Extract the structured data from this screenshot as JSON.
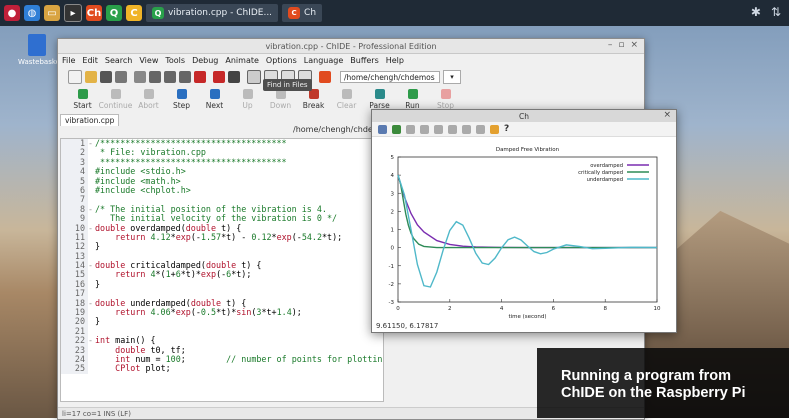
{
  "taskbar": {
    "tasks": [
      "vibration.cpp - ChIDE...",
      "Ch"
    ],
    "tray": [
      "bluetooth",
      "network"
    ]
  },
  "desktop": {
    "trash_label": "Wastebasket"
  },
  "window": {
    "title": "vibration.cpp - ChIDE - Professional Edition",
    "controls": [
      "–",
      "▫",
      "×"
    ],
    "menu": [
      "File",
      "Edit",
      "Search",
      "View",
      "Tools",
      "Debug",
      "Animate",
      "Options",
      "Language",
      "Buffers",
      "Help"
    ],
    "path_value": "/home/chengh/chdemos",
    "tooltip": "Find in Files",
    "debug_buttons": [
      {
        "label": "Start",
        "enabled": true
      },
      {
        "label": "Continue",
        "enabled": false
      },
      {
        "label": "Abort",
        "enabled": false
      },
      {
        "label": "Step",
        "enabled": true
      },
      {
        "label": "Next",
        "enabled": true
      },
      {
        "label": "Up",
        "enabled": false
      },
      {
        "label": "Down",
        "enabled": false
      },
      {
        "label": "Break",
        "enabled": true
      },
      {
        "label": "Clear",
        "enabled": false
      },
      {
        "label": "Parse",
        "enabled": true
      },
      {
        "label": "Run",
        "enabled": true
      },
      {
        "label": "Stop",
        "enabled": false
      }
    ],
    "tab": "vibration.cpp",
    "file_path": "/home/chengh/chdemos/vi",
    "status": "li=17 co=1 INS (LF)"
  },
  "code": [
    {
      "n": "1",
      "fold": "-",
      "parts": [
        [
          "comment",
          "/*************************************"
        ]
      ]
    },
    {
      "n": "2",
      "fold": "",
      "parts": [
        [
          "comment",
          " * File: vibration.cpp"
        ]
      ]
    },
    {
      "n": "3",
      "fold": "",
      "parts": [
        [
          "comment",
          " *************************************"
        ]
      ]
    },
    {
      "n": "4",
      "fold": "",
      "parts": [
        [
          "comment",
          "#include <stdio.h>"
        ]
      ]
    },
    {
      "n": "5",
      "fold": "",
      "parts": [
        [
          "comment",
          "#include <math.h>"
        ]
      ]
    },
    {
      "n": "6",
      "fold": "",
      "parts": [
        [
          "comment",
          "#include <chplot.h>"
        ]
      ]
    },
    {
      "n": "7",
      "fold": "",
      "parts": [
        [
          "plain",
          ""
        ]
      ]
    },
    {
      "n": "8",
      "fold": "-",
      "parts": [
        [
          "comment",
          "/* The initial position of the vibration is 4."
        ]
      ]
    },
    {
      "n": "9",
      "fold": "",
      "parts": [
        [
          "comment",
          "   The initial velocity of the vibration is 0 */"
        ]
      ]
    },
    {
      "n": "10",
      "fold": "-",
      "parts": [
        [
          "kw",
          "double "
        ],
        [
          "plain",
          "overdamped("
        ],
        [
          "kw",
          "double "
        ],
        [
          "plain",
          "t) {"
        ]
      ]
    },
    {
      "n": "11",
      "fold": "",
      "parts": [
        [
          "plain",
          "    "
        ],
        [
          "kw",
          "return "
        ],
        [
          "num",
          "4.12"
        ],
        [
          "plain",
          "*"
        ],
        [
          "kw",
          "exp"
        ],
        [
          "plain",
          "(-"
        ],
        [
          "num",
          "1.57"
        ],
        [
          "plain",
          "*t) - "
        ],
        [
          "num",
          "0.12"
        ],
        [
          "plain",
          "*"
        ],
        [
          "kw",
          "exp"
        ],
        [
          "plain",
          "(-"
        ],
        [
          "num",
          "54.2"
        ],
        [
          "plain",
          "*t);"
        ]
      ]
    },
    {
      "n": "12",
      "fold": "",
      "parts": [
        [
          "plain",
          "}"
        ]
      ]
    },
    {
      "n": "13",
      "fold": "",
      "parts": [
        [
          "plain",
          ""
        ]
      ]
    },
    {
      "n": "14",
      "fold": "-",
      "parts": [
        [
          "kw",
          "double "
        ],
        [
          "plain",
          "criticaldamped("
        ],
        [
          "kw",
          "double "
        ],
        [
          "plain",
          "t) {"
        ]
      ]
    },
    {
      "n": "15",
      "fold": "",
      "parts": [
        [
          "plain",
          "    "
        ],
        [
          "kw",
          "return "
        ],
        [
          "num",
          "4"
        ],
        [
          "plain",
          "*("
        ],
        [
          "num",
          "1"
        ],
        [
          "plain",
          "+"
        ],
        [
          "num",
          "6"
        ],
        [
          "plain",
          "*t)*"
        ],
        [
          "kw",
          "exp"
        ],
        [
          "plain",
          "(-"
        ],
        [
          "num",
          "6"
        ],
        [
          "plain",
          "*t);"
        ]
      ]
    },
    {
      "n": "16",
      "fold": "",
      "parts": [
        [
          "plain",
          "}"
        ]
      ]
    },
    {
      "n": "17",
      "fold": "",
      "parts": [
        [
          "plain",
          ""
        ]
      ]
    },
    {
      "n": "18",
      "fold": "-",
      "parts": [
        [
          "kw",
          "double "
        ],
        [
          "plain",
          "underdamped("
        ],
        [
          "kw",
          "double "
        ],
        [
          "plain",
          "t) {"
        ]
      ]
    },
    {
      "n": "19",
      "fold": "",
      "parts": [
        [
          "plain",
          "    "
        ],
        [
          "kw",
          "return "
        ],
        [
          "num",
          "4.06"
        ],
        [
          "plain",
          "*"
        ],
        [
          "kw",
          "exp"
        ],
        [
          "plain",
          "(-"
        ],
        [
          "num",
          "0.5"
        ],
        [
          "plain",
          "*t)*"
        ],
        [
          "kw",
          "sin"
        ],
        [
          "plain",
          "("
        ],
        [
          "num",
          "3"
        ],
        [
          "plain",
          "*t+"
        ],
        [
          "num",
          "1.4"
        ],
        [
          "plain",
          ");"
        ]
      ]
    },
    {
      "n": "20",
      "fold": "",
      "parts": [
        [
          "plain",
          "}"
        ]
      ]
    },
    {
      "n": "21",
      "fold": "",
      "parts": [
        [
          "plain",
          ""
        ]
      ]
    },
    {
      "n": "22",
      "fold": "-",
      "parts": [
        [
          "kw",
          "int "
        ],
        [
          "plain",
          "main() {"
        ]
      ]
    },
    {
      "n": "23",
      "fold": "",
      "parts": [
        [
          "plain",
          "    "
        ],
        [
          "kw",
          "double "
        ],
        [
          "plain",
          "t0, tf;"
        ]
      ]
    },
    {
      "n": "24",
      "fold": "",
      "parts": [
        [
          "plain",
          "    "
        ],
        [
          "kw",
          "int "
        ],
        [
          "plain",
          "num = "
        ],
        [
          "num",
          "100"
        ],
        [
          "plain",
          ";        "
        ],
        [
          "comment",
          "// number of points for plotting"
        ]
      ]
    },
    {
      "n": "25",
      "fold": "",
      "parts": [
        [
          "plain",
          "    "
        ],
        [
          "kw",
          "CPlot "
        ],
        [
          "plain",
          "plot;"
        ]
      ]
    }
  ],
  "plot_window": {
    "title": "Ch",
    "close": "×",
    "coords": "9.61150, 6.17817"
  },
  "colors": {
    "overdamped": "#7a2db0",
    "critically_damped": "#2e8b57",
    "underdamped": "#4fb8c9",
    "comment": "#1a7a2a",
    "keyword": "#b0122c"
  },
  "chart_data": {
    "type": "line",
    "title": "Damped Free Vibration",
    "xlabel": "time (second)",
    "ylabel": "",
    "xlim": [
      0,
      10
    ],
    "ylim": [
      -3,
      5
    ],
    "xticks": [
      0,
      2,
      4,
      6,
      8,
      10
    ],
    "yticks": [
      -3,
      -2,
      -1,
      0,
      1,
      2,
      3,
      4,
      5
    ],
    "legend_position": "top-right",
    "grid": false,
    "series": [
      {
        "name": "overdamped",
        "color": "#7a2db0",
        "x": [
          0,
          0.25,
          0.5,
          0.75,
          1,
          1.5,
          2,
          2.5,
          3,
          4,
          5,
          6,
          7,
          8,
          10
        ],
        "y": [
          4,
          2.78,
          1.88,
          1.26,
          0.86,
          0.39,
          0.18,
          0.08,
          0.04,
          0.01,
          0,
          0,
          0,
          0,
          0
        ]
      },
      {
        "name": "critically damped",
        "color": "#2e8b57",
        "x": [
          0,
          0.1,
          0.2,
          0.3,
          0.4,
          0.5,
          0.6,
          0.8,
          1,
          1.5,
          2,
          3,
          10
        ],
        "y": [
          4,
          3.51,
          2.66,
          1.85,
          1.23,
          0.8,
          0.51,
          0.19,
          0.07,
          0.0,
          0,
          0,
          0
        ]
      },
      {
        "name": "underdamped",
        "color": "#4fb8c9",
        "x": [
          0,
          0.25,
          0.5,
          0.75,
          1,
          1.25,
          1.5,
          1.75,
          2,
          2.25,
          2.5,
          2.75,
          3,
          3.25,
          3.5,
          3.75,
          4,
          4.25,
          4.5,
          4.75,
          5,
          5.25,
          5.5,
          5.75,
          6,
          6.5,
          7,
          7.5,
          8,
          9,
          10
        ],
        "y": [
          4.0,
          2.89,
          1.0,
          -0.93,
          -2.1,
          -2.17,
          -1.35,
          -0.11,
          0.95,
          1.43,
          1.24,
          0.52,
          -0.31,
          -0.85,
          -0.93,
          -0.57,
          -0.01,
          0.44,
          0.58,
          0.42,
          0.09,
          -0.22,
          -0.34,
          -0.27,
          -0.08,
          0.15,
          0.07,
          -0.06,
          -0.04,
          0.02,
          0.0
        ]
      }
    ]
  },
  "caption": {
    "line1": "Running a program from",
    "line2": "ChIDE on the Raspberry Pi"
  }
}
